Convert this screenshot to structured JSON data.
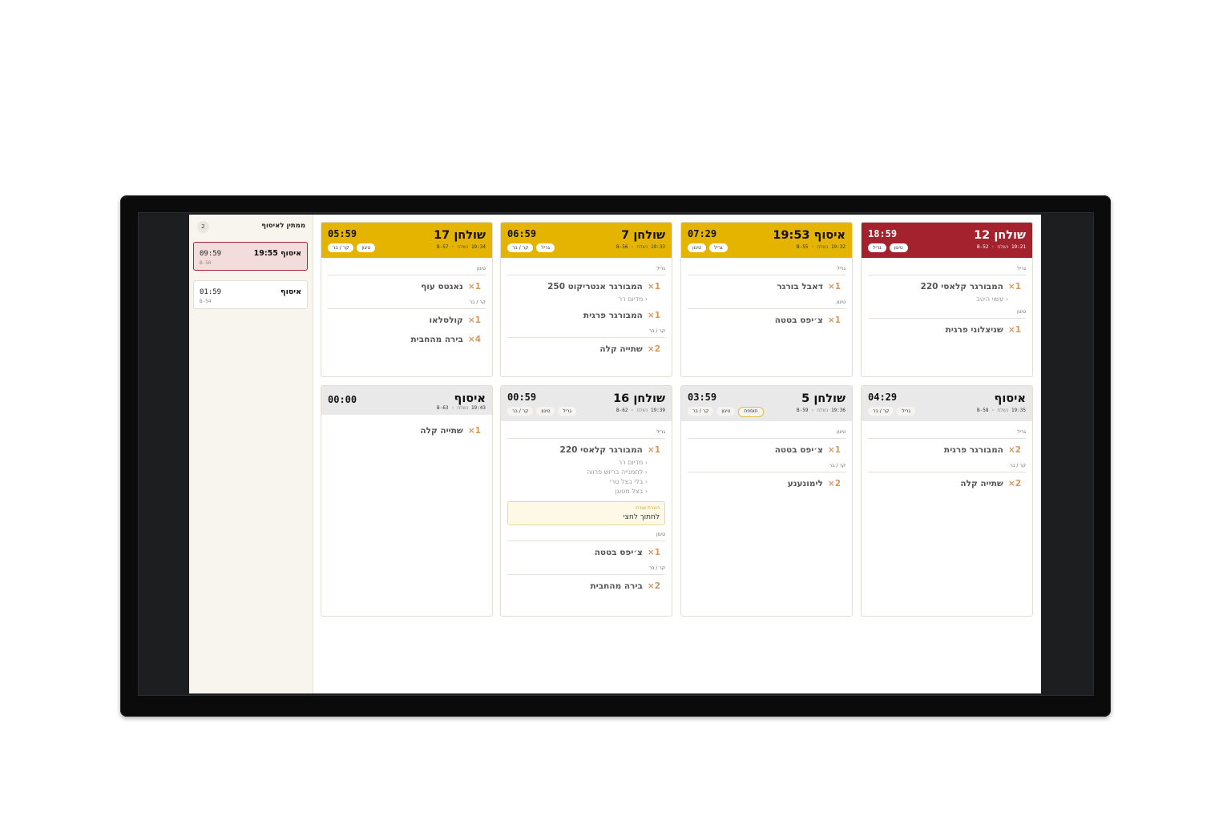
{
  "waitlist": {
    "title": "ממתין לאיסוף",
    "count": "2",
    "items": [
      {
        "name": "איסוף 19:55",
        "timer": "09:59",
        "code": "B-50"
      },
      {
        "name": "איסוף",
        "timer": "01:59",
        "code": "B-54"
      }
    ]
  },
  "status_colors": {
    "late": "#a3222d",
    "warning": "#e4b400",
    "new": "#e9e9e9"
  },
  "tickets": [
    {
      "title": "שולחן 12",
      "timer": "18:59",
      "sent_label": "נשלח",
      "sent_time": "19:21",
      "code": "B-52",
      "chips": [
        "גריל",
        "טיגון"
      ],
      "stations": [
        {
          "name": "גריל",
          "items": [
            {
              "qty": "×1",
              "name": "המבורגר קלאסי 220",
              "mods": [
                "עשוי היטב"
              ]
            }
          ]
        },
        {
          "name": "טיגון",
          "items": [
            {
              "qty": "×1",
              "name": "שניצלוני פרגית"
            }
          ]
        }
      ]
    },
    {
      "title": "איסוף 19:53",
      "timer": "07:29",
      "sent_label": "נשלח",
      "sent_time": "19:32",
      "code": "B-55",
      "chips": [
        "גריל",
        "טיגון"
      ],
      "stations": [
        {
          "name": "גריל",
          "items": [
            {
              "qty": "×1",
              "name": "דאבל בורגר"
            }
          ]
        },
        {
          "name": "טיגון",
          "items": [
            {
              "qty": "×1",
              "name": "צ׳יפס בטטה"
            }
          ]
        }
      ]
    },
    {
      "title": "שולחן 7",
      "timer": "06:59",
      "sent_label": "נשלח",
      "sent_time": "19:33",
      "code": "B-56",
      "chips": [
        "גריל",
        "קר / בר"
      ],
      "stations": [
        {
          "name": "גריל",
          "items": [
            {
              "qty": "×1",
              "name": "המבורגר אנטריקוט 250",
              "mods": [
                "מדיום רר"
              ]
            },
            {
              "qty": "×1",
              "name": "המבורגר פרגית"
            }
          ]
        },
        {
          "name": "קר / בר",
          "items": [
            {
              "qty": "×2",
              "name": "שתייה קלה"
            }
          ]
        }
      ]
    },
    {
      "title": "שולחן 17",
      "timer": "05:59",
      "sent_label": "נשלח",
      "sent_time": "19:34",
      "code": "B-57",
      "chips": [
        "טיגון",
        "קר / בר"
      ],
      "stations": [
        {
          "name": "טיגון",
          "items": [
            {
              "qty": "×1",
              "name": "נאגטס עוף"
            }
          ]
        },
        {
          "name": "קר / בר",
          "items": [
            {
              "qty": "×1",
              "name": "קולסלאו"
            },
            {
              "qty": "×4",
              "name": "בירה מהחבית"
            }
          ]
        }
      ]
    },
    {
      "title": "איסוף",
      "timer": "04:29",
      "sent_label": "נשלח",
      "sent_time": "19:35",
      "code": "B-58",
      "chips": [
        "גריל",
        "קר / בר"
      ],
      "stations": [
        {
          "name": "גריל",
          "items": [
            {
              "qty": "×2",
              "name": "המבורגר פרגית"
            }
          ]
        },
        {
          "name": "קר / בר",
          "items": [
            {
              "qty": "×2",
              "name": "שתייה קלה"
            }
          ]
        }
      ]
    },
    {
      "title": "שולחן 5",
      "timer": "03:59",
      "sent_label": "נשלח",
      "sent_time": "19:36",
      "code": "B-59",
      "chips": [
        "תוספת",
        "טיגון",
        "קר / בר"
      ],
      "stations": [
        {
          "name": "טיגון",
          "items": [
            {
              "qty": "×1",
              "name": "צ׳יפס בטטה"
            }
          ]
        },
        {
          "name": "קר / בר",
          "items": [
            {
              "qty": "×2",
              "name": "לימונענע"
            }
          ]
        }
      ]
    },
    {
      "title": "שולחן 16",
      "timer": "00:59",
      "sent_label": "נשלח",
      "sent_time": "19:39",
      "code": "B-62",
      "chips": [
        "גריל",
        "טיגון",
        "קר / בר"
      ],
      "stations": [
        {
          "name": "גריל",
          "items": [
            {
              "qty": "×1",
              "name": "המבורגר קלאסי 220",
              "mods": [
                "מדיום רר",
                "לחמנייה בריוש פרווה",
                "בלי בצל טרי",
                "בצל מטוגן"
              ]
            }
          ],
          "note": {
            "label": "הערת אורח",
            "text": "לחתוך לחצי"
          }
        },
        {
          "name": "טיגון",
          "items": [
            {
              "qty": "×1",
              "name": "צ׳יפס בטטה"
            }
          ]
        },
        {
          "name": "קר / בר",
          "items": [
            {
              "qty": "×2",
              "name": "בירה מהחבית"
            }
          ]
        }
      ]
    },
    {
      "title": "איסוף",
      "timer": "00:00",
      "sent_label": "נשלח",
      "sent_time": "19:43",
      "code": "B-63",
      "chips": [],
      "stations": [
        {
          "name": "",
          "items": [
            {
              "qty": "×1",
              "name": "שתייה קלה"
            }
          ]
        }
      ]
    }
  ]
}
